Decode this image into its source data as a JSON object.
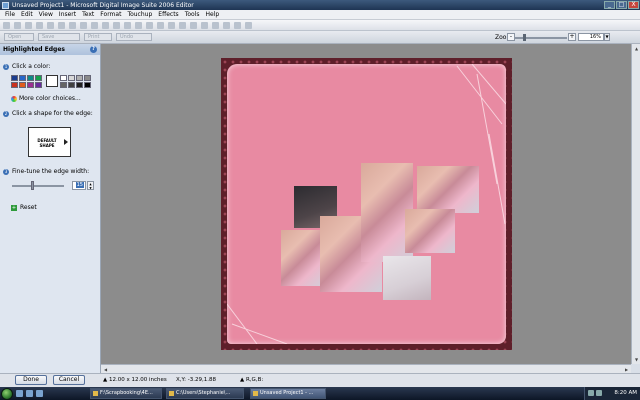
{
  "window": {
    "title": "Unsaved Project1 - Microsoft Digital Image Suite 2006 Editor",
    "controls": [
      "_",
      "□",
      "X"
    ]
  },
  "menu": [
    "File",
    "Edit",
    "View",
    "Insert",
    "Text",
    "Format",
    "Touchup",
    "Effects",
    "Tools",
    "Help"
  ],
  "toolbar2": {
    "buttons": [
      "Open",
      "Save",
      "Print",
      "Undo"
    ],
    "zoom_label": "Zoom",
    "zoom_value": "16%",
    "zoom_level_percent": 16,
    "minus": "-",
    "plus": "+"
  },
  "panel": {
    "title": "Highlighted Edges",
    "help": "?",
    "step1": {
      "num": "1",
      "label": "Click a color:"
    },
    "step2": {
      "num": "2",
      "label": "Click a shape for the edge:"
    },
    "step3": {
      "num": "3",
      "label": "Fine-tune the edge width:"
    },
    "more_colors": "More color choices...",
    "shape_label": "DEFAULT SHAPE",
    "edge_width_value": "15",
    "reset_label": "Reset",
    "colors": [
      "#1b3d8f",
      "#2767c9",
      "#0f8a87",
      "#15a24b",
      "#c8321f",
      "#e05c1c",
      "#9b2f8f",
      "#6a2a9c"
    ],
    "grays": [
      "#ffffff",
      "#d8d8d8",
      "#b0b0b0",
      "#8a8a8a",
      "#656565",
      "#404040",
      "#202020",
      "#000000"
    ]
  },
  "dialog": {
    "done_label": "Done",
    "cancel_label": "Cancel"
  },
  "status": {
    "size": "12.00 x 12.00 inches",
    "xy": "X,Y: -3.29,1.88",
    "rgb": "R,G,B:"
  },
  "taskbar": {
    "tasks": [
      {
        "label": "F:\\Scrapbooking\\4E..."
      },
      {
        "label": "C:\\Users\\Stephanie\\..."
      },
      {
        "label": "Unsaved Project1 - ..."
      }
    ],
    "clock": "8:20 AM"
  }
}
